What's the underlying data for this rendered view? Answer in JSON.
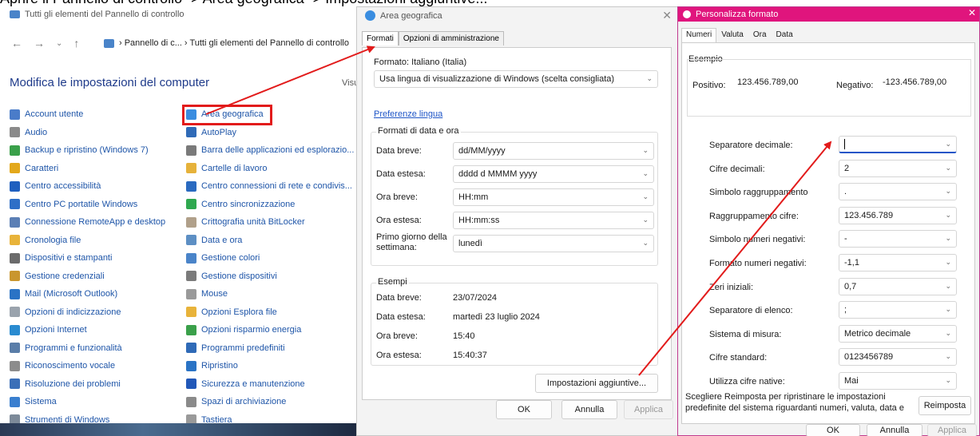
{
  "caption": "Aprire il Pannello di controllo -> Area geografica -> Impostazioni aggiuntive...",
  "control_panel": {
    "window_title": "Tutti gli elementi del Pannello di controllo",
    "address": "› Pannello di c... › Tutti gli elementi del Pannello di controllo",
    "heading": "Modifica le impostazioni del computer",
    "view_label": "Visu",
    "column1": [
      {
        "label": "Account utente",
        "color": "#4a7cc9"
      },
      {
        "label": "Audio",
        "color": "#8a8a8a"
      },
      {
        "label": "Backup e ripristino (Windows 7)",
        "color": "#3aa04a"
      },
      {
        "label": "Caratteri",
        "color": "#e3a81b"
      },
      {
        "label": "Centro accessibilità",
        "color": "#1f5fbf"
      },
      {
        "label": "Centro PC portatile Windows",
        "color": "#2e6fc7"
      },
      {
        "label": "Connessione RemoteApp e desktop",
        "color": "#5b7fb5"
      },
      {
        "label": "Cronologia file",
        "color": "#e8b33a"
      },
      {
        "label": "Dispositivi e stampanti",
        "color": "#6b6b6b"
      },
      {
        "label": "Gestione credenziali",
        "color": "#c9962e"
      },
      {
        "label": "Mail (Microsoft Outlook)",
        "color": "#2a73c5"
      },
      {
        "label": "Opzioni di indicizzazione",
        "color": "#9aa3ad"
      },
      {
        "label": "Opzioni Internet",
        "color": "#2a8bd0"
      },
      {
        "label": "Programmi e funzionalità",
        "color": "#5a7da8"
      },
      {
        "label": "Riconoscimento vocale",
        "color": "#8c8c8c"
      },
      {
        "label": "Risoluzione dei problemi",
        "color": "#3b6fb8"
      },
      {
        "label": "Sistema",
        "color": "#3a7fcf"
      },
      {
        "label": "Strumenti di Windows",
        "color": "#7d8a99"
      }
    ],
    "column2": [
      {
        "label": "Area geografica",
        "color": "#3a8de0"
      },
      {
        "label": "AutoPlay",
        "color": "#2f6ab7"
      },
      {
        "label": "Barra delle applicazioni ed esplorazio...",
        "color": "#7a7a7a"
      },
      {
        "label": "Cartelle di lavoro",
        "color": "#e6b23a"
      },
      {
        "label": "Centro connessioni di rete e condivis...",
        "color": "#2a6ac0"
      },
      {
        "label": "Centro sincronizzazione",
        "color": "#2fa84f"
      },
      {
        "label": "Crittografia unità BitLocker",
        "color": "#b0a08a"
      },
      {
        "label": "Data e ora",
        "color": "#5d8fc4"
      },
      {
        "label": "Gestione colori",
        "color": "#4a84c9"
      },
      {
        "label": "Gestione dispositivi",
        "color": "#7b7b7b"
      },
      {
        "label": "Mouse",
        "color": "#9a9a9a"
      },
      {
        "label": "Opzioni Esplora file",
        "color": "#e8b33a"
      },
      {
        "label": "Opzioni risparmio energia",
        "color": "#3aa04a"
      },
      {
        "label": "Programmi predefiniti",
        "color": "#2f6ab7"
      },
      {
        "label": "Ripristino",
        "color": "#2a73c5"
      },
      {
        "label": "Sicurezza e manutenzione",
        "color": "#2258b8"
      },
      {
        "label": "Spazi di archiviazione",
        "color": "#8a8a8a"
      },
      {
        "label": "Tastiera",
        "color": "#9a9a9a"
      }
    ]
  },
  "area_geografica": {
    "window_title": "Area geografica",
    "close": "✕",
    "tabs": [
      "Formati",
      "Opzioni di amministrazione"
    ],
    "format_label": "Formato: Italiano (Italia)",
    "format_value": "Usa lingua di visualizzazione di Windows (scelta consigliata)",
    "language_link": "Preferenze lingua",
    "date_group_title": "Formati di data e ora",
    "date_rows": [
      {
        "label": "Data breve:",
        "value": "dd/MM/yyyy"
      },
      {
        "label": "Data estesa:",
        "value": "dddd d MMMM yyyy"
      },
      {
        "label": "Ora breve:",
        "value": "HH:mm"
      },
      {
        "label": "Ora estesa:",
        "value": "HH:mm:ss"
      },
      {
        "label": "Primo giorno della settimana:",
        "value": "lunedì"
      }
    ],
    "examples_title": "Esempi",
    "examples": [
      {
        "label": "Data breve:",
        "value": "23/07/2024"
      },
      {
        "label": "Data estesa:",
        "value": "martedì 23 luglio 2024"
      },
      {
        "label": "Ora breve:",
        "value": "15:40"
      },
      {
        "label": "Ora estesa:",
        "value": "15:40:37"
      }
    ],
    "additional_button": "Impostazioni aggiuntive...",
    "ok": "OK",
    "cancel": "Annulla",
    "apply": "Applica"
  },
  "personalizza": {
    "window_title": "Personalizza formato",
    "close": "✕",
    "tabs": [
      "Numeri",
      "Valuta",
      "Ora",
      "Data"
    ],
    "example_title": "Esempio",
    "positive_label": "Positivo:",
    "positive_value": "123.456.789,00",
    "negative_label": "Negativo:",
    "negative_value": "-123.456.789,00",
    "rows": [
      {
        "label": "Separatore decimale:",
        "value": ""
      },
      {
        "label": "Cifre decimali:",
        "value": "2"
      },
      {
        "label": "Simbolo raggruppamento",
        "value": "."
      },
      {
        "label": "Raggruppamento cifre:",
        "value": "123.456.789"
      },
      {
        "label": "Simbolo numeri negativi:",
        "value": "-"
      },
      {
        "label": "Formato numeri negativi:",
        "value": "-1,1"
      },
      {
        "label": "Zeri iniziali:",
        "value": "0,7"
      },
      {
        "label": "Separatore di elenco:",
        "value": ";"
      },
      {
        "label": "Sistema di misura:",
        "value": "Metrico decimale"
      },
      {
        "label": "Cifre standard:",
        "value": "0123456789"
      },
      {
        "label": "Utilizza cifre native:",
        "value": "Mai"
      }
    ],
    "reset_text": "Scegliere Reimposta per ripristinare le impostazioni predefinite del sistema riguardanti numeri, valuta, data e",
    "reset_button": "Reimposta",
    "ok": "OK",
    "cancel": "Annulla",
    "apply": "Applica"
  },
  "accent_colors": {
    "annotation_red": "#e21b1b",
    "title_pink": "#e0157d",
    "link_blue": "#1e55c7"
  }
}
